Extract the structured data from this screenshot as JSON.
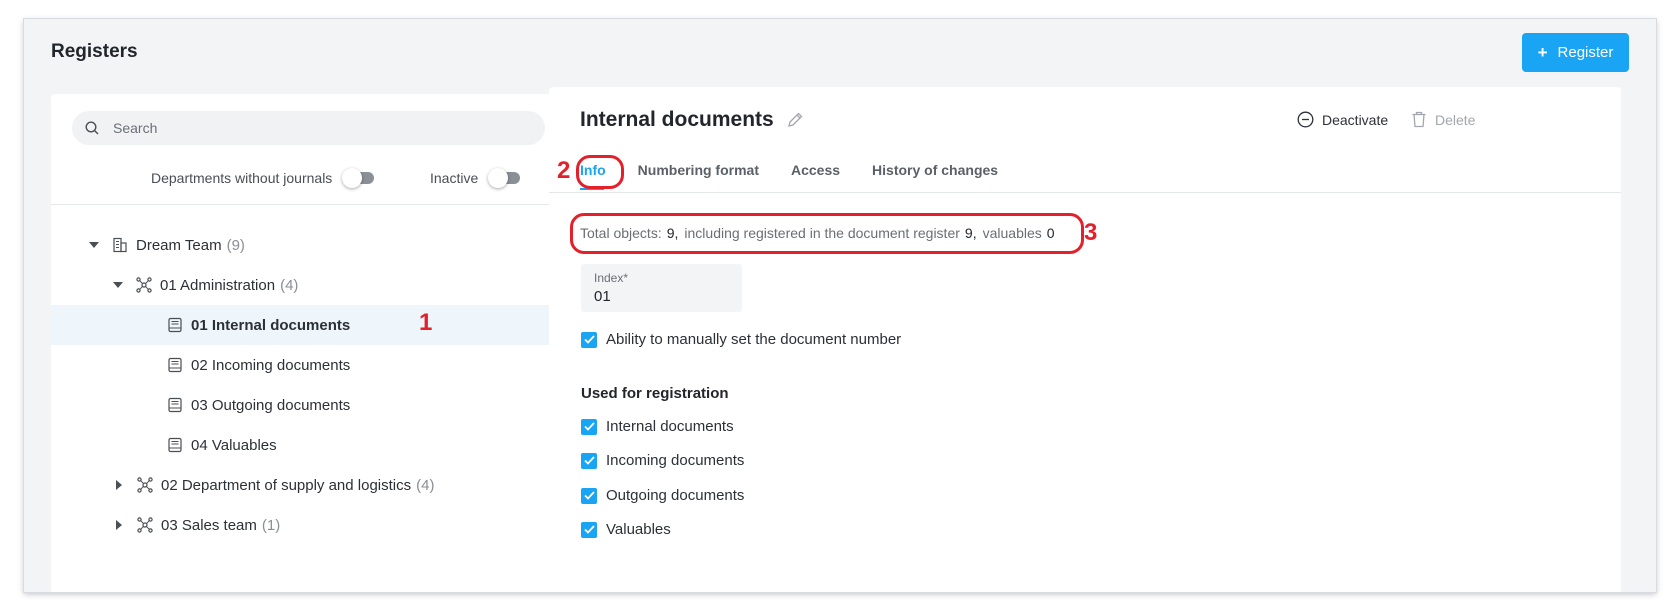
{
  "header": {
    "title": "Registers",
    "register_button": "Register"
  },
  "sidebar": {
    "search_placeholder": "Search",
    "filters": {
      "departments_without_journals": "Departments without journals",
      "inactive": "Inactive"
    },
    "tree": [
      {
        "label": "Dream Team",
        "count": "(9)",
        "expanded": true
      },
      {
        "label": "01 Administration",
        "count": "(4)",
        "expanded": true
      },
      {
        "label": "01 Internal documents",
        "selected": true
      },
      {
        "label": "02 Incoming documents"
      },
      {
        "label": "03 Outgoing documents"
      },
      {
        "label": "04 Valuables"
      },
      {
        "label": "02 Department of supply and logistics",
        "count": "(4)",
        "expanded": false
      },
      {
        "label": "03 Sales team",
        "count": "(1)",
        "expanded": false
      }
    ]
  },
  "detail": {
    "title": "Internal documents",
    "actions": {
      "deactivate": "Deactivate",
      "delete": "Delete"
    },
    "tabs": [
      {
        "label": "Info",
        "active": true
      },
      {
        "label": "Numbering format"
      },
      {
        "label": "Access"
      },
      {
        "label": "History of changes"
      }
    ],
    "summary": {
      "total_label": "Total objects:",
      "total_value": "9,",
      "registered_label": "including registered in the document register",
      "registered_value": "9,",
      "valuables_label": "valuables",
      "valuables_value": "0"
    },
    "index_field": {
      "label": "Index*",
      "value": "01"
    },
    "manual_number": "Ability to manually set the document number",
    "used_for_title": "Used for registration",
    "used_for": [
      "Internal documents",
      "Incoming documents",
      "Outgoing documents",
      "Valuables"
    ]
  },
  "annotations": {
    "marker_1": "1",
    "marker_2": "2",
    "marker_3": "3"
  },
  "colors": {
    "accent": "#1aa4f4",
    "annotation": "#e4202a",
    "background": "#f3f4f6"
  }
}
